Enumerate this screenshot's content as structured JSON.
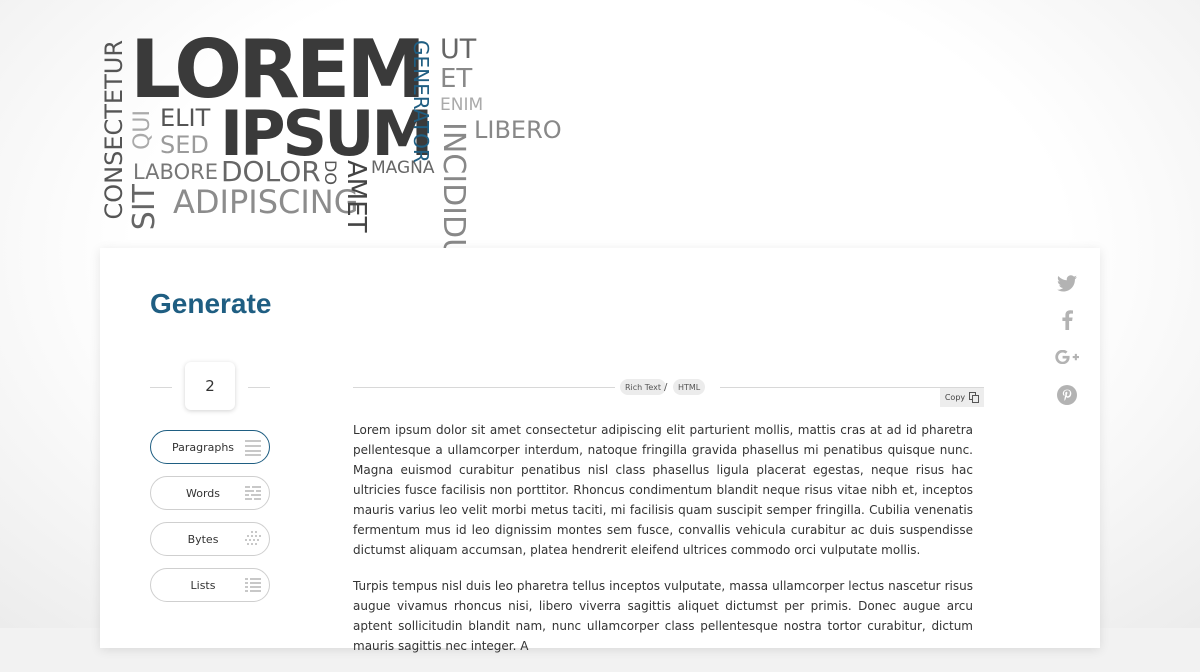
{
  "word_cloud": {
    "lorem": "LOREM",
    "ipsum": "IPSUM",
    "elit": "ELIT",
    "sed": "SED",
    "labore": "LABORE",
    "dolor": "DOLOR",
    "adipiscing": "ADIPISCING",
    "magna": "MAGNA",
    "ut": "UT",
    "et": "ET",
    "enim": "ENIM",
    "libero": "LIBERO",
    "consectetur": "CONSECTETUR",
    "qui": "QUI",
    "sit": "SIT",
    "do": "DO",
    "amet": "AMET",
    "generator": "GENERATOR",
    "incididu": "INCIDIDU"
  },
  "generate": {
    "title": "Generate",
    "count": "2"
  },
  "options": [
    {
      "label": "Paragraphs",
      "active": true
    },
    {
      "label": "Words",
      "active": false
    },
    {
      "label": "Bytes",
      "active": false
    },
    {
      "label": "Lists",
      "active": false
    }
  ],
  "format": {
    "rich_text": "Rich Text",
    "separator": "/",
    "html": "HTML",
    "copy": "Copy"
  },
  "output": {
    "paragraphs": [
      "Lorem ipsum dolor sit amet consectetur adipiscing elit parturient mollis, mattis cras at ad id pharetra pellentesque a ullamcorper interdum, natoque fringilla gravida phasellus mi penatibus quisque nunc. Magna euismod curabitur penatibus nisl class phasellus ligula placerat egestas, neque risus hac ultricies fusce facilisis non porttitor. Rhoncus condimentum blandit neque risus vitae nibh et, inceptos mauris varius leo velit morbi metus taciti, mi facilisis quam suscipit semper fringilla. Cubilia venenatis fermentum mus id leo dignissim montes sem fusce, convallis vehicula curabitur ac duis suspendisse dictumst aliquam accumsan, platea hendrerit eleifend ultrices commodo orci vulputate mollis.",
      "Turpis tempus nisl duis leo pharetra tellus inceptos vulputate, massa ullamcorper lectus nascetur risus augue vivamus rhoncus nisi, libero viverra sagittis aliquet dictumst per primis. Donec augue arcu aptent sollicitudin blandit nam, nunc ullamcorper class pellentesque nostra tortor curabitur, dictum mauris sagittis nec integer. A"
    ]
  },
  "social": {
    "twitter": "twitter-icon",
    "facebook": "facebook-icon",
    "google_plus": "google-plus-icon",
    "pinterest": "pinterest-icon"
  },
  "colors": {
    "accent": "#1f5e82",
    "text": "#333333"
  }
}
